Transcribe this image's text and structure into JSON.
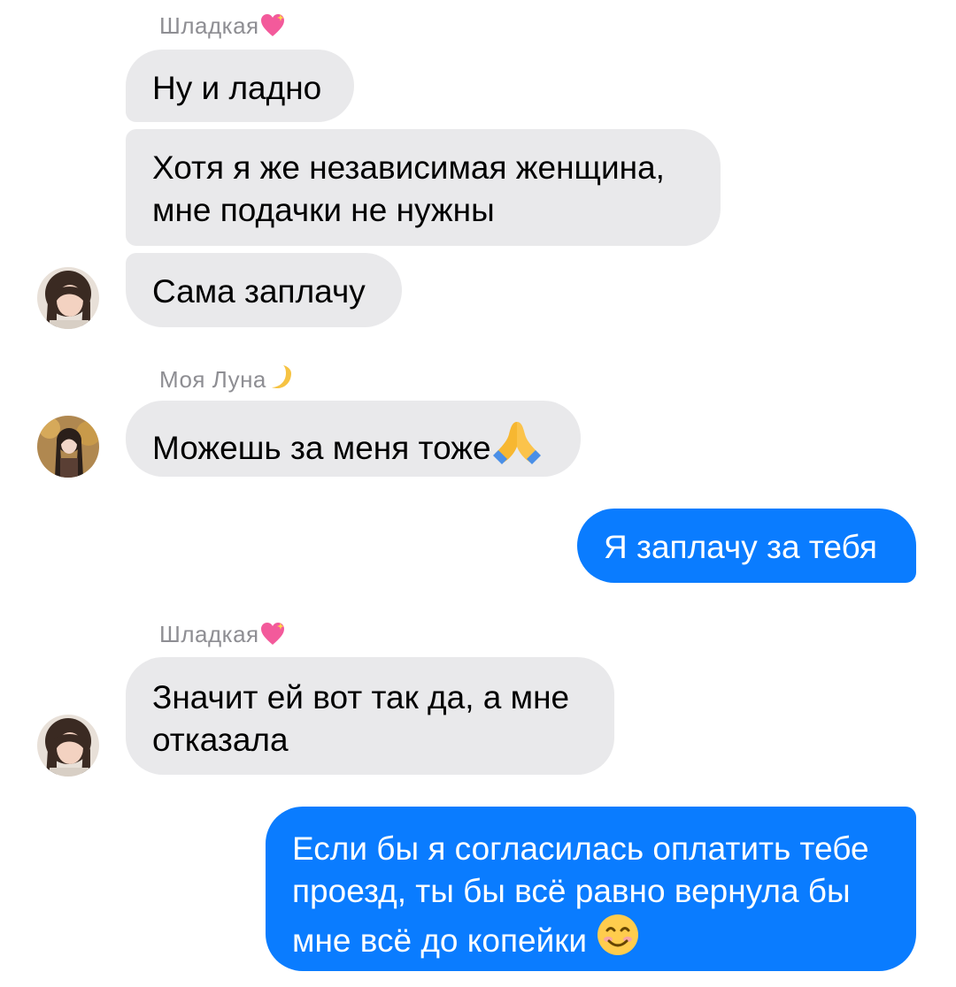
{
  "colors": {
    "incoming_bubble": "#e9e9eb",
    "outgoing_bubble": "#0a7cff",
    "sender_name": "#8e8e93"
  },
  "messages": [
    {
      "sender": "Шладкая",
      "sender_emoji": "sparkling-heart-emoji",
      "text": "Ну и ладно"
    },
    {
      "text_line1": "Хотя я же независимая женщина,",
      "text_line2": "мне подачки не нужны"
    },
    {
      "text": "Сама заплачу",
      "avatar": "avatar-shladkaya"
    },
    {
      "sender": "Моя Луна",
      "sender_emoji": "crescent-moon-emoji",
      "text": "Можешь за меня тоже",
      "text_emoji": "folded-hands-emoji",
      "avatar": "avatar-moya-luna"
    },
    {
      "outgoing": true,
      "text": "Я заплачу за тебя"
    },
    {
      "sender": "Шладкая",
      "sender_emoji": "sparkling-heart-emoji",
      "text_line1": "Значит ей вот так да, а мне",
      "text_line2": "отказала",
      "avatar": "avatar-shladkaya"
    },
    {
      "outgoing": true,
      "text_line1": "Если бы я согласилась оплатить тебе",
      "text_line2": "проезд, ты бы всё равно вернула бы",
      "text_line3": "мне всё до копейки",
      "text_emoji": "smiling-face-emoji"
    }
  ]
}
